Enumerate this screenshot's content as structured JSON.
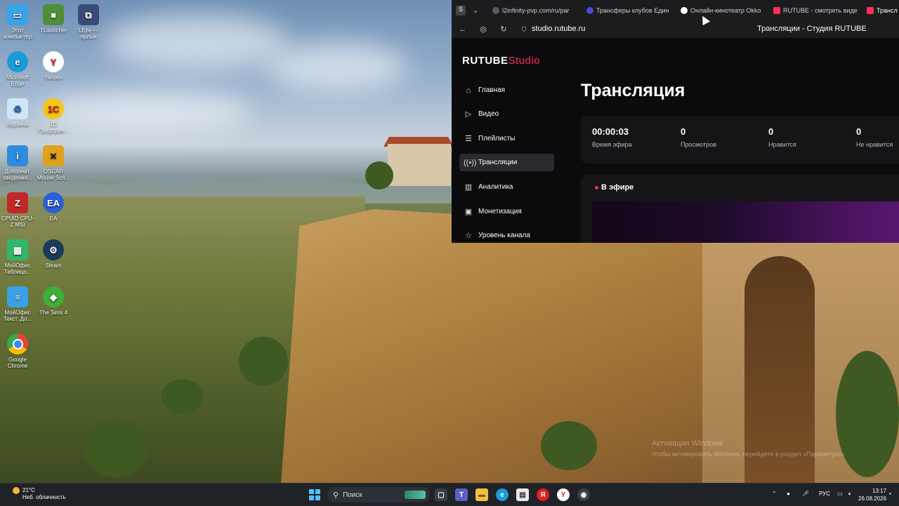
{
  "desktop": {
    "icons": [
      {
        "label": "Этот компьютер",
        "icon": "computer-icon",
        "color": "#3aa3e8"
      },
      {
        "label": "TLauncher",
        "icon": "tlauncher-icon",
        "color": "#4f8f3a"
      },
      {
        "label": "LEze — ярлык",
        "icon": "shortcut-icon",
        "color": "#3c4a7a"
      },
      {
        "label": "Microsoft Edge",
        "icon": "edge-icon",
        "color": "#1b9bd8"
      },
      {
        "label": "Yandex",
        "icon": "yandex-icon",
        "color": "#ffffff"
      },
      {
        "label": "Корзина",
        "icon": "recycle-bin-icon",
        "color": "#cfe6f7"
      },
      {
        "label": "1С Предприя...",
        "icon": "1c-icon",
        "color": "#f5c518"
      },
      {
        "label": "Дополнит. сведения...",
        "icon": "info-icon",
        "color": "#2d8ce0"
      },
      {
        "label": "OSCAR Mouse Scri...",
        "icon": "oscar-icon",
        "color": "#e0a020"
      },
      {
        "label": "CPUID CPU-Z MSI",
        "icon": "cpuz-icon",
        "color": "#c0282a"
      },
      {
        "label": "EA",
        "icon": "ea-icon",
        "color": "#2b5fd8"
      },
      {
        "label": "МойОфис Таблица...",
        "icon": "myoffice-table-icon",
        "color": "#2fb86a"
      },
      {
        "label": "Steam",
        "icon": "steam-icon",
        "color": "#1b3b5a"
      },
      {
        "label": "МойОфис Текст. До...",
        "icon": "myoffice-text-icon",
        "color": "#3aa0e8"
      },
      {
        "label": "The Sims 4",
        "icon": "sims-icon",
        "color": "#3fae3a"
      },
      {
        "label": "Google Chrome",
        "icon": "chrome-icon",
        "color": "#ea4335"
      }
    ],
    "watermark_title": "Активация Windows",
    "watermark_sub": "Чтобы активировать Windows, перейдите в раздел «Параметры»."
  },
  "browser": {
    "tabs": [
      {
        "label": "l2infinity-pvp.com/ru/par",
        "icon": "globe-icon",
        "color": "#5a5a66"
      },
      {
        "label": "Трансферы клубов Един",
        "icon": "sports-icon",
        "color": "#4a4adc"
      },
      {
        "label": "Онлайн-кинотеатр Okko",
        "icon": "okko-icon",
        "color": "#ffffff"
      },
      {
        "label": "RUTUBE - смотреть виде",
        "icon": "rutube-icon",
        "color": "#ff2e5a"
      },
      {
        "label": "Трансл",
        "icon": "rutube-studio-icon",
        "color": "#ff2e5a"
      }
    ],
    "url": "studio.rutube.ru",
    "page_title": "Трансляции - Студия RUTUBE"
  },
  "studio": {
    "logo_main": "RUTUBE",
    "logo_sub": "Studio",
    "nav": [
      {
        "label": "Главная",
        "icon": "home-icon"
      },
      {
        "label": "Видео",
        "icon": "video-icon"
      },
      {
        "label": "Плейлисты",
        "icon": "playlist-icon"
      },
      {
        "label": "Трансляции",
        "icon": "broadcast-icon"
      },
      {
        "label": "Аналитика",
        "icon": "analytics-icon"
      },
      {
        "label": "Монетизация",
        "icon": "money-icon"
      },
      {
        "label": "Уровень канала",
        "icon": "star-icon"
      }
    ],
    "active_nav": "Трансляции",
    "heading": "Трансляция",
    "stats": [
      {
        "value": "00:00:03",
        "label": "Время эфира"
      },
      {
        "value": "0",
        "label": "Просмотров"
      },
      {
        "value": "0",
        "label": "Нравится"
      },
      {
        "value": "0",
        "label": "Не нравится"
      }
    ],
    "live_label": "В эфире"
  },
  "taskbar": {
    "weather_temp": "21°C",
    "weather_desc": "Неб. облачность",
    "search_placeholder": "Поиск",
    "lang": "РУС",
    "time": "13:17",
    "date": "26.08.2026"
  }
}
